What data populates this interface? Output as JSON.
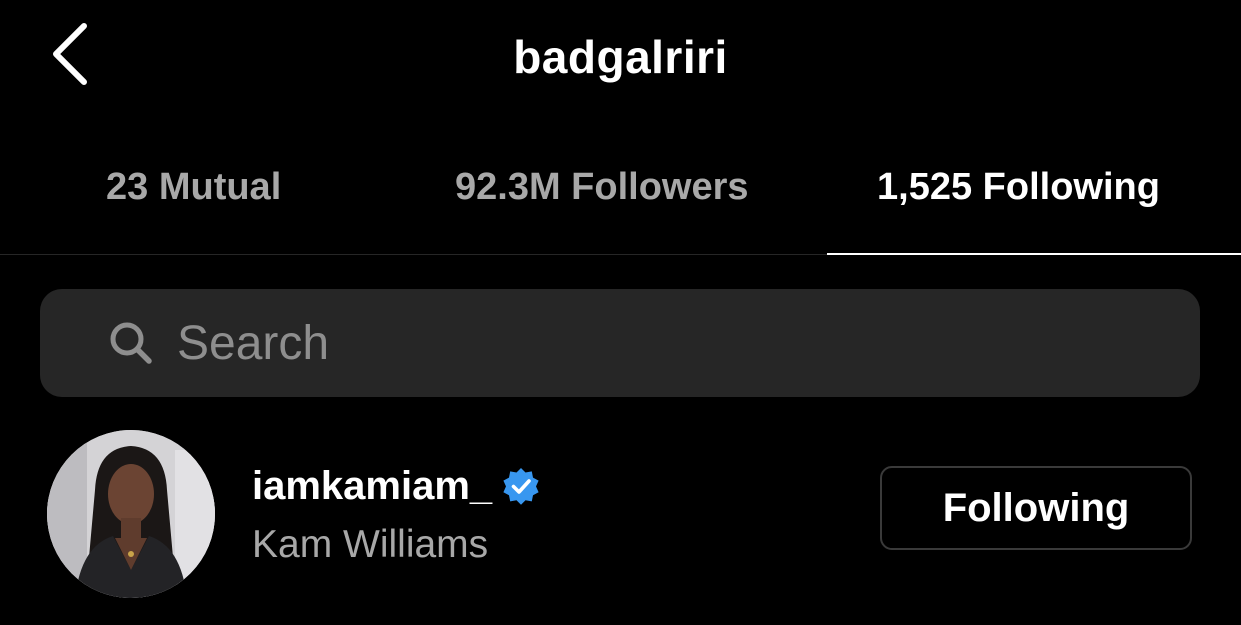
{
  "header": {
    "title": "badgalriri",
    "back_icon": "chevron-left-icon"
  },
  "tabs": [
    {
      "label": "23 Mutual",
      "active": false
    },
    {
      "label": "92.3M Followers",
      "active": false
    },
    {
      "label": "1,525 Following",
      "active": true
    }
  ],
  "search": {
    "placeholder": "Search",
    "value": "",
    "icon": "search-icon"
  },
  "list": [
    {
      "username": "iamkamiam_",
      "full_name": "Kam Williams",
      "verified": true,
      "button_label": "Following"
    }
  ],
  "colors": {
    "background": "#000000",
    "secondary_text": "#a8a8a8",
    "search_bg": "#262626",
    "verified_blue": "#3897f0"
  }
}
